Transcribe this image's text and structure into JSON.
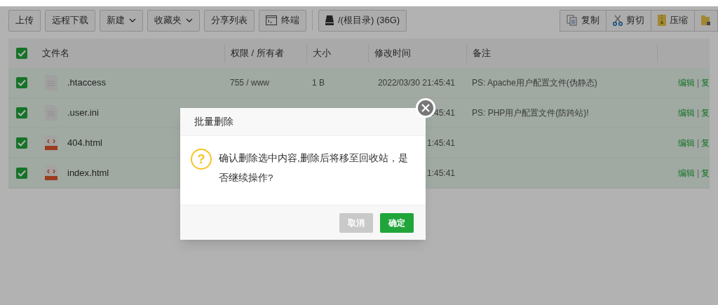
{
  "toolbar": {
    "left": [
      {
        "label": "上传",
        "kind": "plain"
      },
      {
        "label": "远程下载",
        "kind": "plain"
      },
      {
        "label": "新建",
        "kind": "dropdown"
      },
      {
        "label": "收藏夹",
        "kind": "dropdown"
      },
      {
        "label": "分享列表",
        "kind": "plain"
      },
      {
        "label": "终端",
        "kind": "terminal"
      },
      {
        "label": "/(根目录) (36G)",
        "kind": "disk"
      }
    ],
    "right": [
      {
        "label": "复制",
        "kind": "copy"
      },
      {
        "label": "剪切",
        "kind": "cut"
      },
      {
        "label": "压缩",
        "kind": "zip"
      },
      {
        "kind": "lock"
      }
    ]
  },
  "table": {
    "all_checked": true,
    "columns": [
      "文件名",
      "权限 / 所有者",
      "大小",
      "修改时间",
      "备注"
    ],
    "rows": [
      {
        "name": ".htaccess",
        "kind": "text",
        "perms": "755 / www",
        "size": "1 B",
        "time": "2022/03/30 21:45:41",
        "note": "PS: Apache用户配置文件(伪静态)",
        "actions": [
          "编辑",
          "复"
        ],
        "checked": true
      },
      {
        "name": ".user.ini",
        "kind": "text",
        "perms": "",
        "size": "",
        "time": ":45:41",
        "note": "PS: PHP用户配置文件(防跨站)!",
        "actions": [
          "编辑",
          "复"
        ],
        "checked": true
      },
      {
        "name": "404.html",
        "kind": "html",
        "perms": "",
        "size": "",
        "time": "1:45:41",
        "note": "",
        "actions": [
          "编辑",
          "复"
        ],
        "checked": true
      },
      {
        "name": "index.html",
        "kind": "html",
        "perms": "",
        "size": "",
        "time": "1:45:41",
        "note": "",
        "actions": [
          "编辑",
          "复"
        ],
        "checked": true
      }
    ]
  },
  "action_separator": "|",
  "dialog": {
    "title": "批量删除",
    "icon_glyph": "?",
    "message": "确认删除选中内容,删除后将移至回收站，是否继续操作?",
    "buttons": [
      {
        "label": "取消",
        "kind": "cancel"
      },
      {
        "label": "确定",
        "kind": "confirm"
      }
    ]
  }
}
